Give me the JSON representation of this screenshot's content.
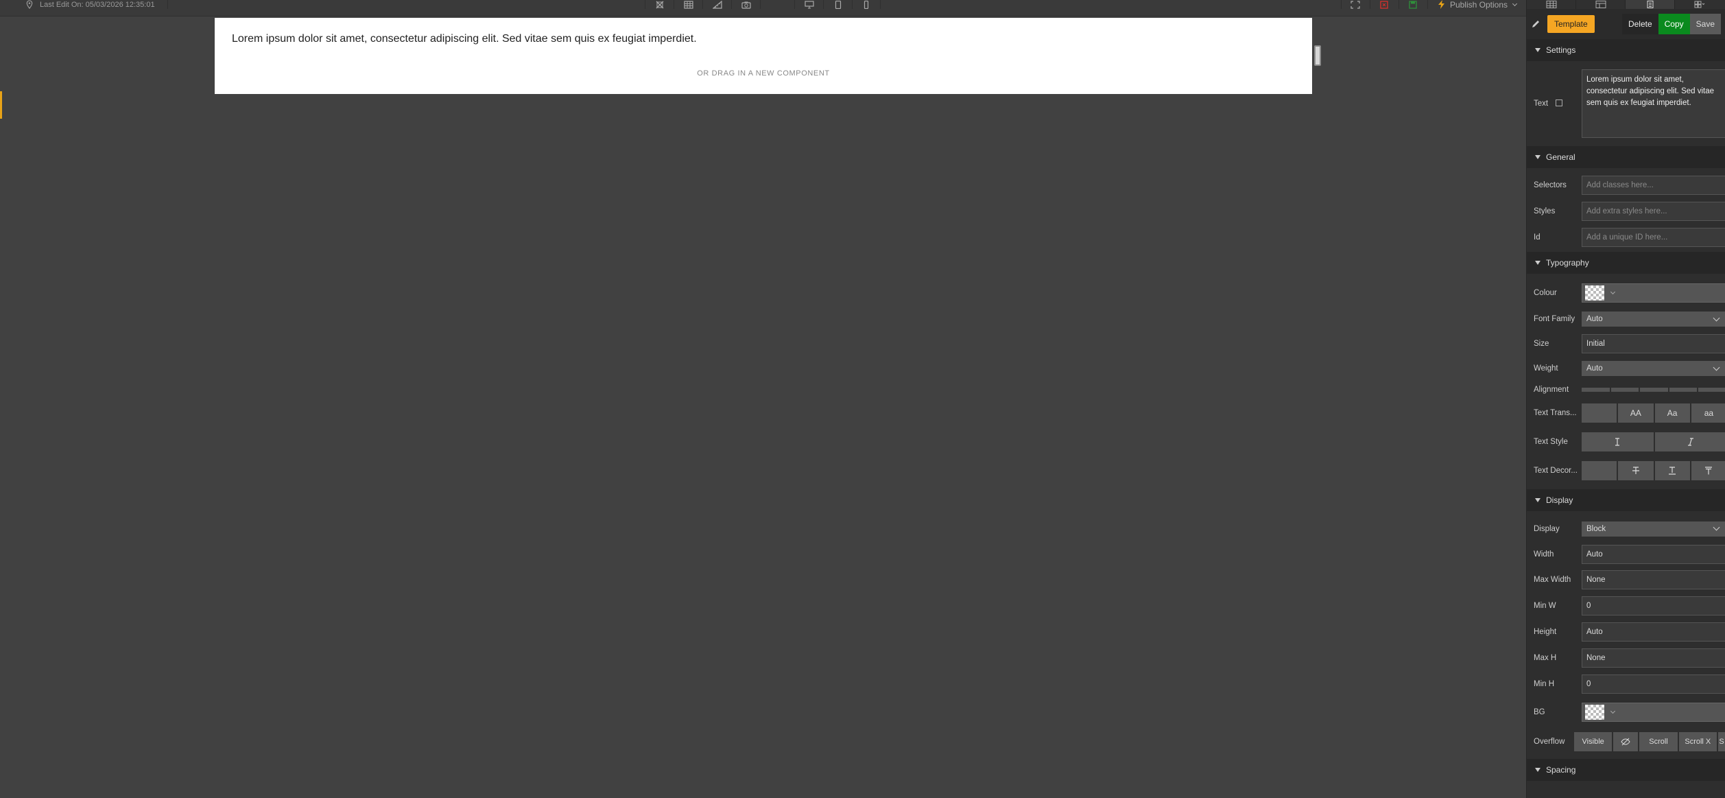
{
  "topbar": {
    "last_edit": "Last Edit On: 05/03/2026 12:35:01",
    "publish_label": "Publish Options"
  },
  "canvas": {
    "text": "Lorem ipsum dolor sit amet, consectetur adipiscing elit. Sed vitae sem quis ex feugiat imperdiet.",
    "hint": "OR DRAG IN A NEW COMPONENT"
  },
  "panel": {
    "actions": {
      "template": "Template",
      "delete": "Delete",
      "copy": "Copy",
      "save": "Save"
    },
    "settings": {
      "title": "Settings",
      "text_label": "Text",
      "text_value": "Lorem ipsum dolor sit amet, consectetur adipiscing elit. Sed vitae sem quis ex feugiat imperdiet."
    },
    "general": {
      "title": "General",
      "selectors_label": "Selectors",
      "selectors_placeholder": "Add classes here...",
      "styles_label": "Styles",
      "styles_placeholder": "Add extra styles here...",
      "id_label": "Id",
      "id_placeholder": "Add a unique ID here..."
    },
    "typography": {
      "title": "Typography",
      "colour_label": "Colour",
      "font_family_label": "Font Family",
      "font_family_value": "Auto",
      "size_label": "Size",
      "size_value": "Initial",
      "weight_label": "Weight",
      "weight_value": "Auto",
      "alignment_label": "Alignment",
      "text_transform_label": "Text Trans...",
      "text_transform_options": [
        "",
        "AA",
        "Aa",
        "aa"
      ],
      "text_style_label": "Text Style",
      "text_decor_label": "Text Decor..."
    },
    "display": {
      "title": "Display",
      "display_label": "Display",
      "display_value": "Block",
      "width_label": "Width",
      "width_value": "Auto",
      "max_width_label": "Max Width",
      "max_width_value": "None",
      "min_w_label": "Min W",
      "min_w_value": "0",
      "height_label": "Height",
      "height_value": "Auto",
      "max_h_label": "Max H",
      "max_h_value": "None",
      "min_h_label": "Min H",
      "min_h_value": "0",
      "bg_label": "BG",
      "overflow_label": "Overflow",
      "overflow_visible": "Visible",
      "overflow_scroll": "Scroll",
      "overflow_scroll_x": "Scroll X",
      "overflow_cut": "S"
    },
    "spacing": {
      "title": "Spacing"
    }
  },
  "colors": {
    "accent": "#f5a623",
    "copy_green": "#0a8a1e",
    "delete_red": "#d9302c",
    "save_green": "#2f8f3a"
  }
}
